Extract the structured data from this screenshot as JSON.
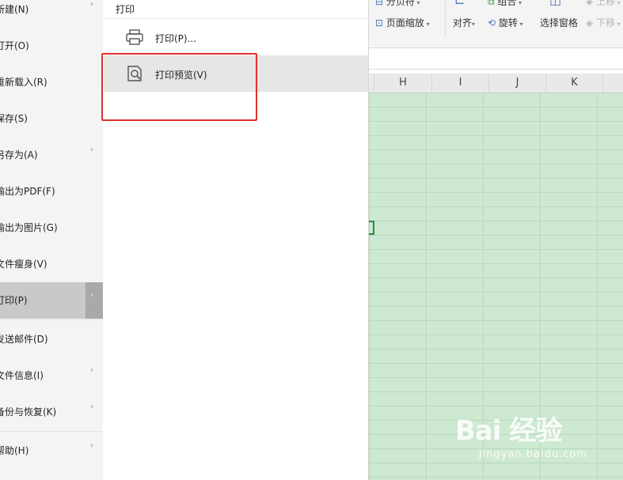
{
  "file_menu": {
    "items": [
      {
        "label": "新建(N)",
        "arrow": "›"
      },
      {
        "label": "打开(O)",
        "arrow": ""
      },
      {
        "label": "重新载入(R)",
        "arrow": ""
      },
      {
        "label": "保存(S)",
        "arrow": ""
      },
      {
        "label": "另存为(A)",
        "arrow": "›"
      },
      {
        "label": "输出为PDF(F)",
        "arrow": ""
      },
      {
        "label": "输出为图片(G)",
        "arrow": ""
      },
      {
        "label": "文件瘦身(V)",
        "arrow": ""
      },
      {
        "label": "打印(P)",
        "arrow": "›"
      },
      {
        "label": "发送邮件(D)",
        "arrow": ""
      },
      {
        "label": "文件信息(I)",
        "arrow": "›"
      },
      {
        "label": "备份与恢复(K)",
        "arrow": "›"
      },
      {
        "label": "帮助(H)",
        "arrow": "›"
      }
    ],
    "selected_label": "打印(P)"
  },
  "submenu": {
    "title": "打印",
    "items": [
      {
        "label": "打印(P)...",
        "icon": "printer-icon"
      },
      {
        "label": "打印预览(V)",
        "icon": "print-preview-icon"
      }
    ]
  },
  "ribbon": {
    "page_break": "分页符",
    "page_zoom": "页面缩放",
    "align": "对齐",
    "group": "组合",
    "rotate": "旋转",
    "selection_pane": "选择窗格",
    "move_up": "上移",
    "move_down": "下移"
  },
  "sheet": {
    "columns": [
      "H",
      "I",
      "J",
      "K"
    ]
  },
  "watermark": {
    "main": "Bai 经验",
    "sub": "jingyan.baidu.com"
  },
  "colors": {
    "highlight_border": "#e0312c",
    "sheet_background": "#cde9d1",
    "menu_selected": "#c9c9c9"
  }
}
